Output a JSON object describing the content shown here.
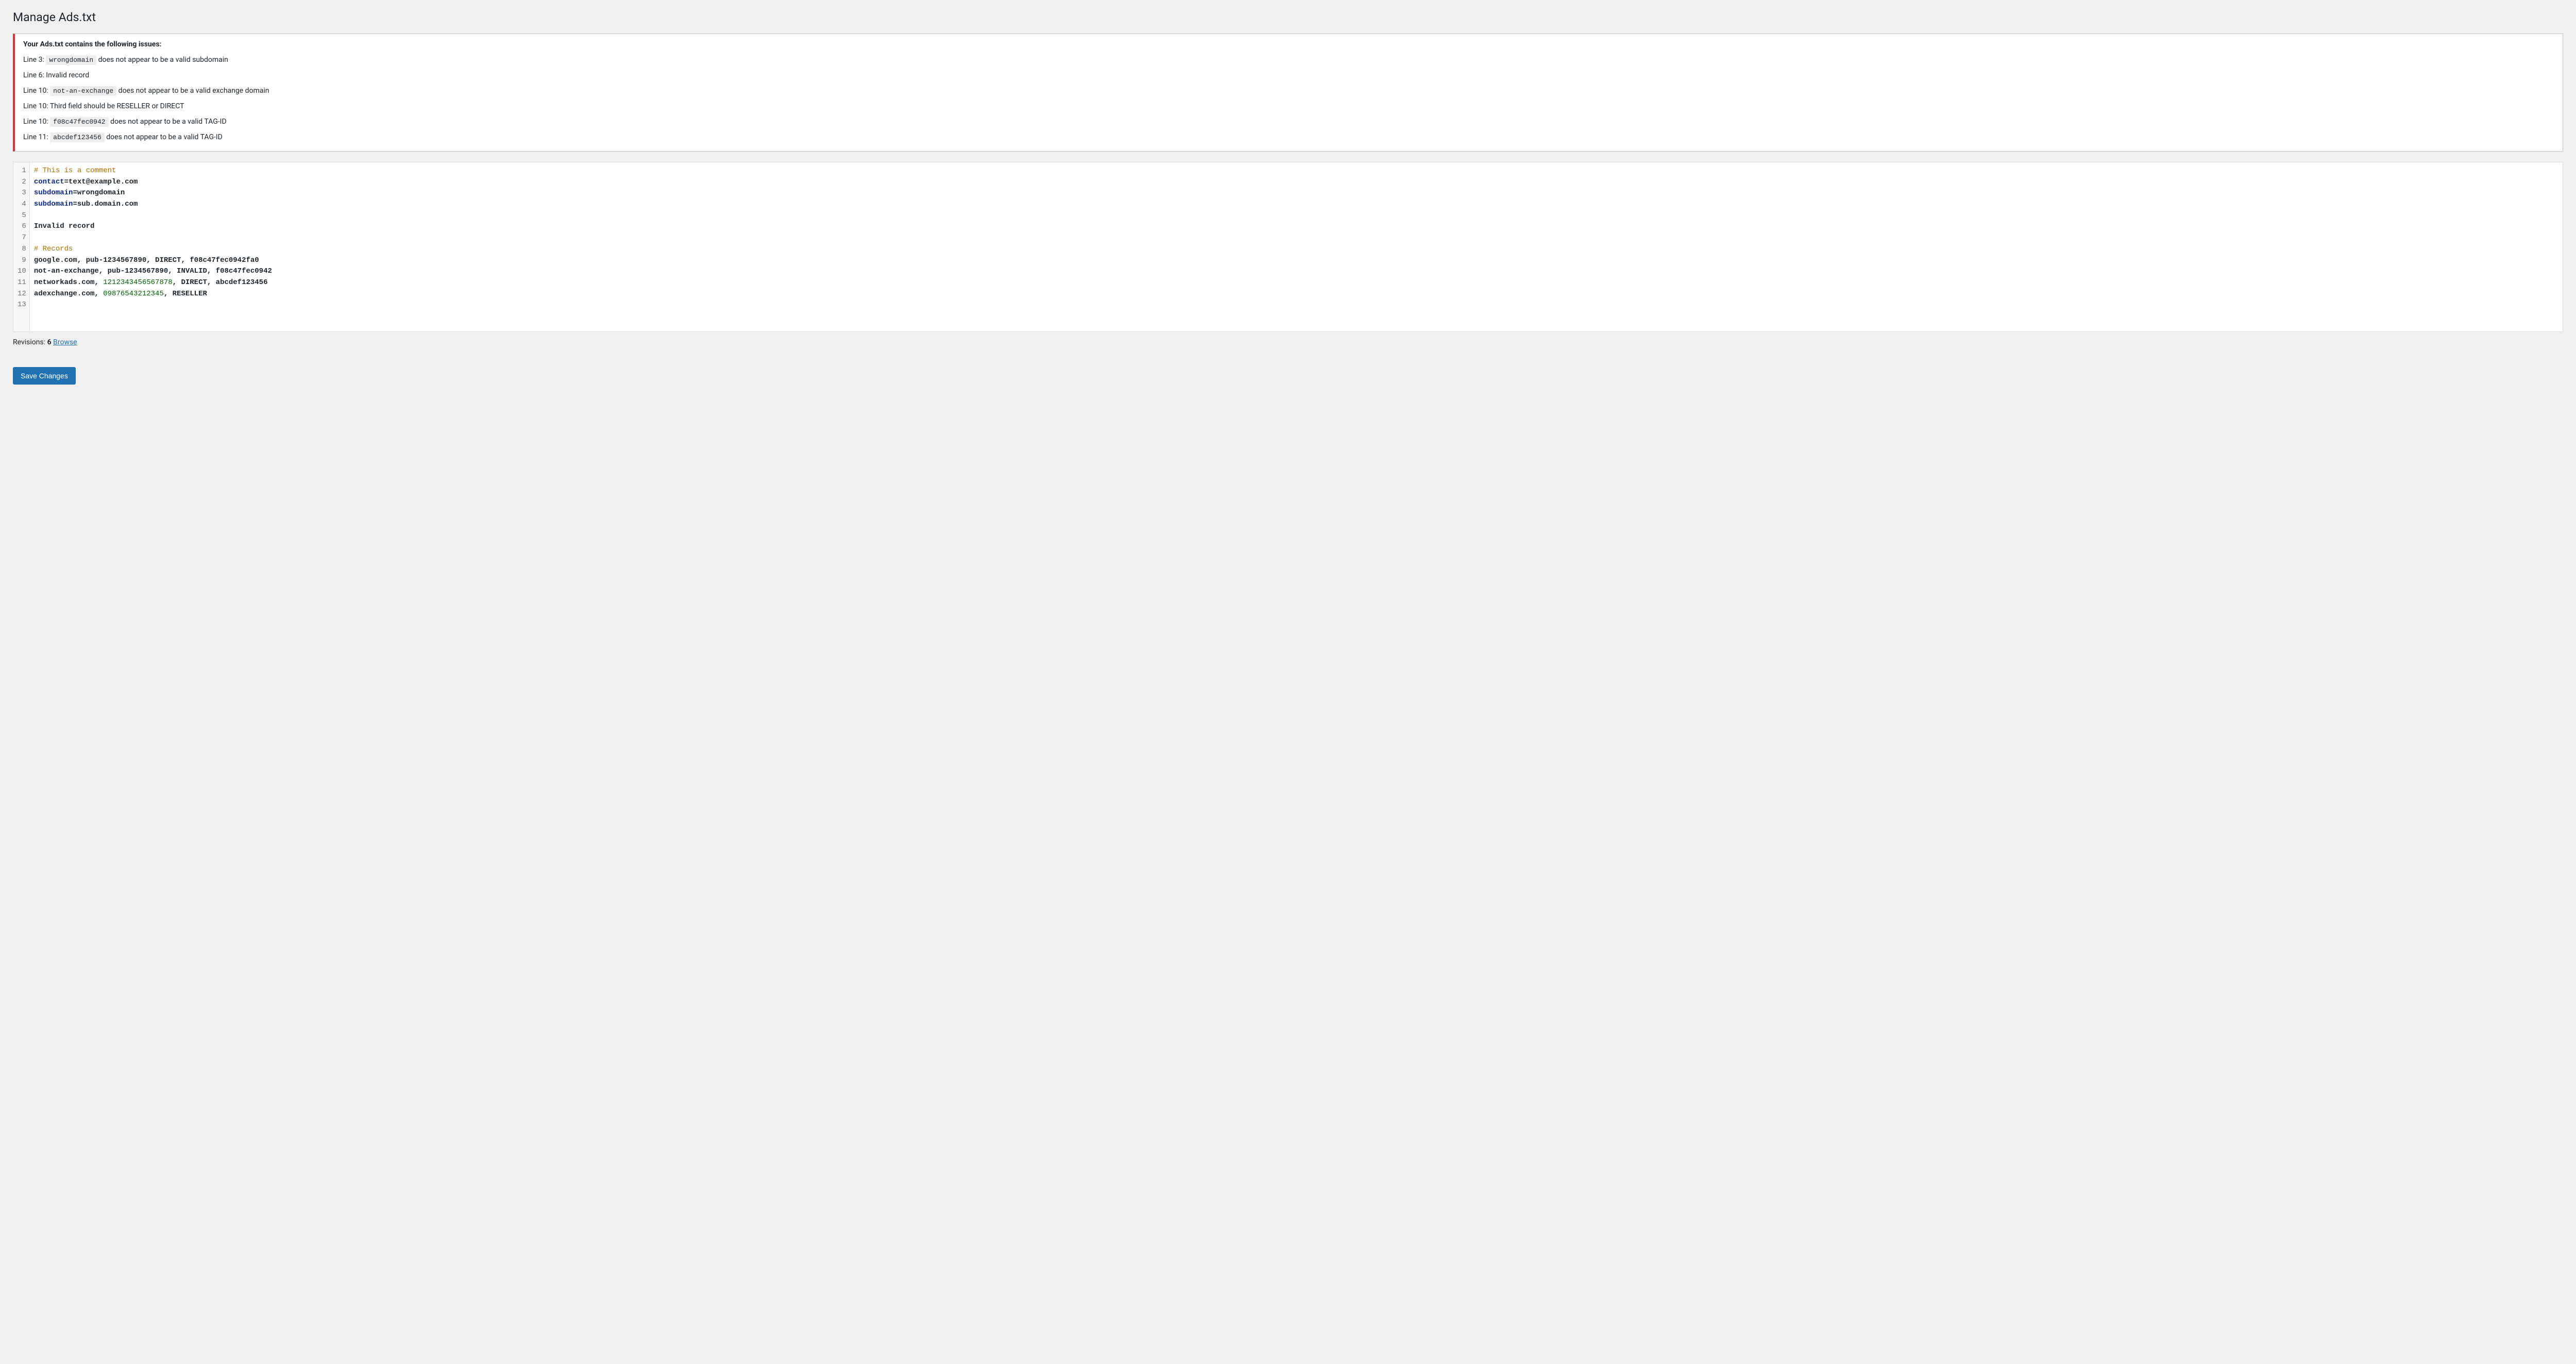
{
  "page": {
    "title": "Manage Ads.txt"
  },
  "notice": {
    "heading": "Your Ads.txt contains the following issues:",
    "issues": [
      {
        "prefix": "Line 3: ",
        "code": "wrongdomain",
        "suffix": " does not appear to be a valid subdomain"
      },
      {
        "prefix": "Line 6: Invalid record",
        "code": "",
        "suffix": ""
      },
      {
        "prefix": "Line 10: ",
        "code": "not-an-exchange",
        "suffix": " does not appear to be a valid exchange domain"
      },
      {
        "prefix": "Line 10: Third field should be RESELLER or DIRECT",
        "code": "",
        "suffix": ""
      },
      {
        "prefix": "Line 10: ",
        "code": "f08c47fec0942",
        "suffix": " does not appear to be a valid TAG-ID"
      },
      {
        "prefix": "Line 11: ",
        "code": "abcdef123456",
        "suffix": " does not appear to be a valid TAG-ID"
      }
    ]
  },
  "editor": {
    "lines": [
      {
        "n": 1,
        "tokens": [
          {
            "t": "# This is a comment",
            "c": "tok-comment"
          }
        ]
      },
      {
        "n": 2,
        "tokens": [
          {
            "t": "contact",
            "c": "tok-keyword"
          },
          {
            "t": "=text@example.com",
            "c": "tok-text"
          }
        ]
      },
      {
        "n": 3,
        "tokens": [
          {
            "t": "subdomain",
            "c": "tok-keyword"
          },
          {
            "t": "=wrongdomain",
            "c": "tok-text"
          }
        ]
      },
      {
        "n": 4,
        "tokens": [
          {
            "t": "subdomain",
            "c": "tok-keyword"
          },
          {
            "t": "=sub.domain.com",
            "c": "tok-text"
          }
        ]
      },
      {
        "n": 5,
        "tokens": [
          {
            "t": "",
            "c": ""
          }
        ]
      },
      {
        "n": 6,
        "tokens": [
          {
            "t": "Invalid record",
            "c": "tok-text"
          }
        ]
      },
      {
        "n": 7,
        "tokens": [
          {
            "t": "",
            "c": ""
          }
        ]
      },
      {
        "n": 8,
        "tokens": [
          {
            "t": "# Records",
            "c": "tok-comment"
          }
        ]
      },
      {
        "n": 9,
        "tokens": [
          {
            "t": "google.com, pub-1234567890, DIRECT, f08c47fec0942fa0",
            "c": "tok-text"
          }
        ]
      },
      {
        "n": 10,
        "tokens": [
          {
            "t": "not-an-exchange, pub-1234567890, INVALID, f08c47fec0942",
            "c": "tok-text"
          }
        ]
      },
      {
        "n": 11,
        "tokens": [
          {
            "t": "networkads.com, ",
            "c": "tok-text"
          },
          {
            "t": "1212343456567878",
            "c": "tok-number"
          },
          {
            "t": ", DIRECT, abcdef123456",
            "c": "tok-text"
          }
        ]
      },
      {
        "n": 12,
        "tokens": [
          {
            "t": "adexchange.com, ",
            "c": "tok-text"
          },
          {
            "t": "09876543212345",
            "c": "tok-number"
          },
          {
            "t": ", RESELLER",
            "c": "tok-text"
          }
        ]
      },
      {
        "n": 13,
        "tokens": [
          {
            "t": "",
            "c": ""
          }
        ]
      }
    ]
  },
  "revisions": {
    "label": "Revisions: ",
    "count": "6",
    "browse": "Browse"
  },
  "buttons": {
    "save": "Save Changes"
  }
}
